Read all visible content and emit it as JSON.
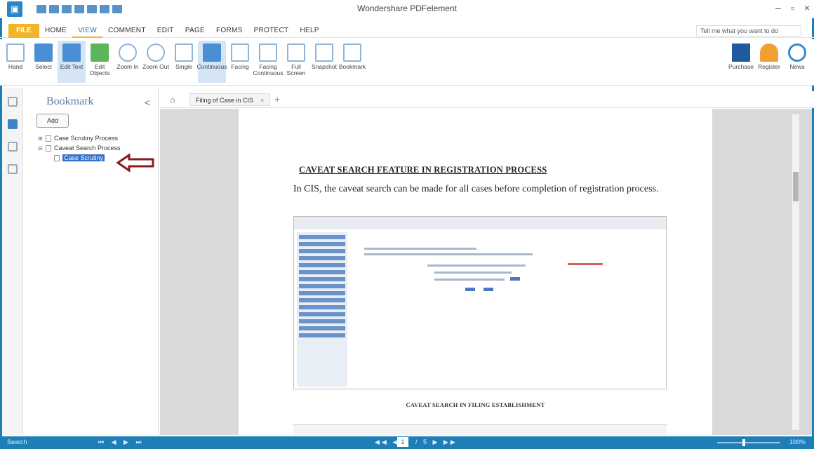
{
  "window": {
    "title": "Wondershare PDFelement",
    "minimize": "–",
    "maximize": "▫",
    "close": "×"
  },
  "menu": {
    "file": "FILE",
    "items": [
      "HOME",
      "VIEW",
      "COMMENT",
      "EDIT",
      "PAGE",
      "FORMS",
      "PROTECT",
      "HELP"
    ],
    "active_index": 1,
    "tell_me_placeholder": "Tell me what you want to do"
  },
  "ribbon": {
    "left": [
      {
        "label": "Hand",
        "icon": "hand-icon"
      },
      {
        "label": "Select",
        "icon": "select-icon"
      },
      {
        "label": "Edit Text",
        "icon": "edit-text-icon",
        "active": true
      },
      {
        "label": "Edit Objects",
        "icon": "edit-objects-icon"
      },
      {
        "label": "Zoom In",
        "icon": "zoom-in-icon"
      },
      {
        "label": "Zoom Out",
        "icon": "zoom-out-icon"
      },
      {
        "label": "Single",
        "icon": "single-page-icon"
      },
      {
        "label": "Continuous",
        "icon": "continuous-icon",
        "active": true
      },
      {
        "label": "Facing",
        "icon": "facing-icon"
      },
      {
        "label": "Facing Continuous",
        "icon": "facing-continuous-icon"
      },
      {
        "label": "Full Screen",
        "icon": "full-screen-icon"
      },
      {
        "label": "Snapshot",
        "icon": "snapshot-icon"
      },
      {
        "label": "Bookmark",
        "icon": "bookmark-icon"
      }
    ],
    "right": [
      {
        "label": "Purchase",
        "icon": "purchase-icon"
      },
      {
        "label": "Register",
        "icon": "register-icon"
      },
      {
        "label": "News",
        "icon": "news-icon"
      }
    ]
  },
  "bookmark_panel": {
    "title": "Bookmark",
    "collapse": "<",
    "add_button": "Add",
    "items": [
      {
        "label": "Case Scrutiny Process",
        "level": 1,
        "expander": "⊞"
      },
      {
        "label": "Caveat Search Process",
        "level": 1,
        "expander": "⊟"
      },
      {
        "label": "Case Scrutiny",
        "level": 2,
        "expander": "",
        "selected": true
      }
    ]
  },
  "tabs": {
    "home": "⌂",
    "document": "Filing of Case in CIS",
    "close": "×",
    "new": "+"
  },
  "document": {
    "heading": "CAVEAT SEARCH FEATURE IN REGISTRATION PROCESS",
    "paragraph": "In CIS, the caveat search can be made for all cases before completion of registration process.",
    "caption": "CAVEAT SEARCH IN FILING ESTABLISHMENT"
  },
  "statusbar": {
    "left": "Search",
    "nav_left": "⏮ ◀ ▶ ⏭",
    "page_prev": "◀◀ ◀",
    "page": "1",
    "page_next": "/ 5 ▶ ▶▶",
    "zoom": "100%"
  },
  "colors": {
    "accent": "#1e7fb8",
    "file_tab": "#f1b52c",
    "selection": "#2f6fcc",
    "arrow": "#8b1a1a"
  }
}
